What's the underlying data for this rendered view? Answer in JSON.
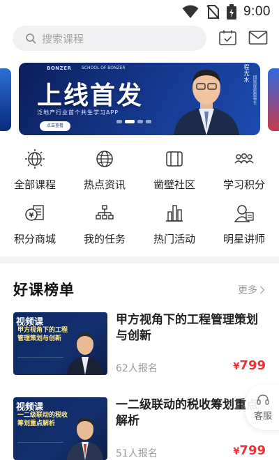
{
  "status_bar": {
    "time": "9:00"
  },
  "search": {
    "placeholder": "搜索课程"
  },
  "banner": {
    "brand": "BONZER",
    "brand_sub": "SCHOOL OF BONZER",
    "headline": "上线首发",
    "subline": "泛地产行业首个共生学习APP",
    "cta": "点击查看",
    "speaker_name": "程光水",
    "speaker_title": "博观观察董事长"
  },
  "categories": [
    {
      "label": "全部课程",
      "icon": "globe-gear-icon"
    },
    {
      "label": "热点资讯",
      "icon": "globe-icon"
    },
    {
      "label": "凿壁社区",
      "icon": "book-icon"
    },
    {
      "label": "学习积分",
      "icon": "people-icon"
    },
    {
      "label": "积分商城",
      "icon": "coin-shop-icon"
    },
    {
      "label": "我的任务",
      "icon": "org-chart-icon"
    },
    {
      "label": "热门活动",
      "icon": "bar-chart-icon"
    },
    {
      "label": "明星讲师",
      "icon": "teacher-icon"
    }
  ],
  "section": {
    "title": "好课榜单",
    "more": "更多"
  },
  "courses": [
    {
      "tag": "视频课",
      "thumb_title": "甲方视角下的工程管理策划与创新",
      "title": "甲方视角下的工程管理策划与创新",
      "enroll": "62人报名",
      "price_symbol": "¥",
      "price": "799"
    },
    {
      "tag": "视频课",
      "thumb_title": "一二级联动的税收筹划重点解析",
      "title": "一二级联动的税收筹划重点解析",
      "enroll": "51人报名",
      "price_symbol": "¥",
      "price": "799"
    }
  ],
  "customer_service": {
    "label": "客服"
  },
  "colors": {
    "accent_red": "#e8353a",
    "banner_blue": "#16398f"
  }
}
